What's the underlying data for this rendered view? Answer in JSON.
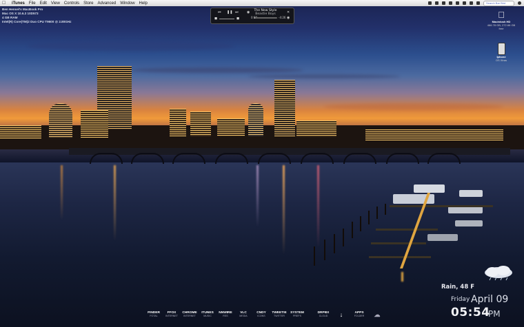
{
  "menubar": {
    "app": "iTunes",
    "items": [
      "File",
      "Edit",
      "View",
      "Controls",
      "Store",
      "Advanced",
      "Window",
      "Help"
    ],
    "search_placeholder": "Search Bar Bird"
  },
  "sysinfo": {
    "lines": [
      "Ben Hensel's MacBook Pro",
      "Mac OS X 10.6.3 10D573",
      "4 GB RAM",
      "Intel(R) Core(TM)2 Duo CPU     T9600  @ 2.80GHz"
    ]
  },
  "itunes_widget": {
    "track": "The New Style",
    "artist": "Beastie Boys",
    "elapsed": "0:09",
    "remaining": "-4:26",
    "progress": 0.03
  },
  "desktop_icons": [
    {
      "label": "Macintosh HD",
      "sub": "466.78 GB, 272.66 GB free"
    },
    {
      "label": "Iphone",
      "sub": "OS Xtras"
    }
  ],
  "weather": {
    "condition": "Rain, 48 F",
    "day": "Friday",
    "date": "April 09",
    "time": "05:54",
    "ampm": "PM"
  },
  "dock": [
    {
      "name": "FINDER",
      "sub": "FOTAL"
    },
    {
      "name": "FFOX",
      "sub": "INTERNET"
    },
    {
      "name": "CHROME",
      "sub": "INTERNET"
    },
    {
      "name": "ITUNES",
      "sub": "MUSIC"
    },
    {
      "name": "NNWIRE",
      "sub": "RSS"
    },
    {
      "name": "VLC",
      "sub": "MEDIA"
    },
    {
      "name": "CNDY",
      "sub": "ICONS"
    },
    {
      "name": "TWEETIE",
      "sub": "TWITTER"
    },
    {
      "name": "SYSTEM",
      "sub": "PREFS"
    },
    {
      "name": "DRPBX",
      "sub": "CLOUD"
    },
    {
      "name": "APPS",
      "sub": "FOLDER"
    }
  ]
}
